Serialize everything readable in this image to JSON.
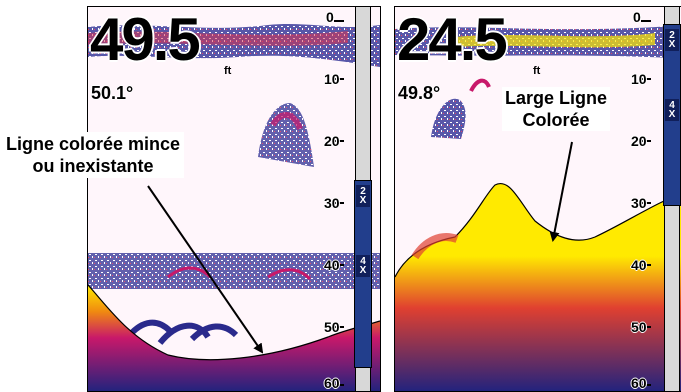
{
  "left_screen": {
    "depth": "49.5",
    "unit": "ft",
    "temperature": "50.1°",
    "scale": [
      "0",
      "10",
      "20",
      "30",
      "40",
      "50",
      "60"
    ],
    "zoom_labels": [
      "2 X",
      "4 X"
    ]
  },
  "right_screen": {
    "depth": "24.5",
    "unit": "ft",
    "temperature": "49.8°",
    "scale": [
      "0",
      "10",
      "20",
      "30",
      "40",
      "50",
      "60"
    ],
    "zoom_labels": [
      "2 X",
      "4 X"
    ]
  },
  "captions": {
    "left_line1": "Ligne colorée mince",
    "left_line2": "ou inexistante",
    "right_line1": "Large Ligne",
    "right_line2": "Colorée"
  },
  "colors": {
    "sonar_bg": "#fff6fb",
    "bottom_yellow": "#ffea00",
    "bottom_red": "#d81e3c",
    "bottom_blue": "#2a2a8c",
    "zoom_bar": "#223e8c"
  }
}
